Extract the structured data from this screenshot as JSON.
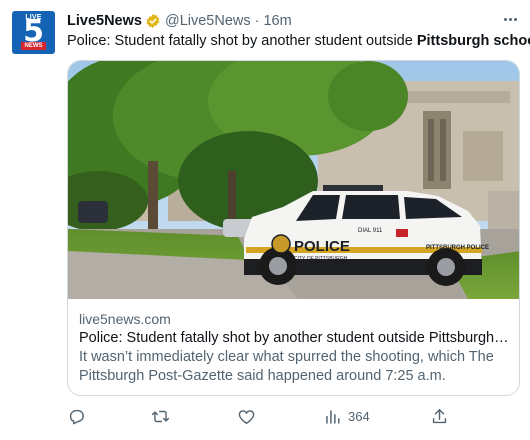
{
  "account": {
    "display_name": "Live5News",
    "handle": "@Live5News",
    "separator": "·",
    "time": "16m",
    "avatar_text": {
      "top": "LIVE",
      "number": "5",
      "bottom": "NEWS"
    },
    "verified_color": "#e2b719"
  },
  "tweet": {
    "text_prefix": "Police: Student fatally shot by another student outside ",
    "text_bold": "Pittsburgh school"
  },
  "card": {
    "image_text": {
      "door_label": "POLICE",
      "door_sub": "CITY OF PITTSBURGH",
      "rear_label": "PITTSBURGH POLICE",
      "dial": "DIAL 911"
    },
    "domain": "live5news.com",
    "title": "Police: Student fatally shot by another student outside Pittsburgh s...",
    "description": "It wasn’t immediately clear what spurred the shooting, which The Pittsburgh Post-Gazette said happened around 7:25 a.m."
  },
  "actions": {
    "reply": "reply-icon",
    "retweet": "retweet-icon",
    "like": "heart-icon",
    "views": {
      "icon": "views-icon",
      "count": "364"
    },
    "share": "share-icon"
  },
  "colors": {
    "text": "#0f1419",
    "secondary": "#536471",
    "border": "#cfd9de",
    "avatar_blue": "#1463b4",
    "avatar_red": "#d8262e"
  }
}
